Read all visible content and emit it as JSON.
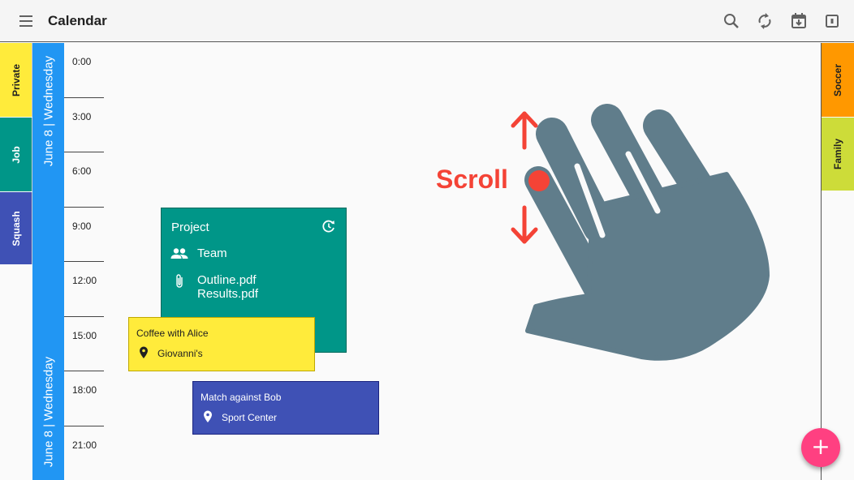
{
  "toolbar": {
    "title": "Calendar",
    "icons": [
      "menu-icon",
      "search-icon",
      "sync-icon",
      "calendar-download-icon",
      "view-day-icon"
    ]
  },
  "left_tabs": [
    {
      "label": "Private",
      "color": "#ffeb3b"
    },
    {
      "label": "Job",
      "color": "#009688"
    },
    {
      "label": "Squash",
      "color": "#3f51b5"
    }
  ],
  "right_tabs": [
    {
      "label": "Soccer",
      "color": "#ff9800"
    },
    {
      "label": "Family",
      "color": "#cddc39"
    }
  ],
  "date_strip": {
    "top_label": "June 8 | Wednesday",
    "bottom_label": "June 8 | Wednesday",
    "color": "#2196f3"
  },
  "times": [
    "0:00",
    "3:00",
    "6:00",
    "9:00",
    "12:00",
    "15:00",
    "18:00",
    "21:00"
  ],
  "events": {
    "project": {
      "title": "Project",
      "attendees": "Team",
      "attachment_1": "Outline.pdf",
      "attachment_2": "Results.pdf",
      "color": "#009688"
    },
    "coffee": {
      "title": "Coffee with Alice",
      "location": "Giovanni's",
      "color": "#ffeb3b"
    },
    "match": {
      "title": "Match against Bob",
      "location": "Sport Center",
      "color": "#3f51b5"
    }
  },
  "overlay": {
    "gesture_label": "Scroll",
    "gesture_icon": "hand-scroll-icon",
    "accent": "#f44336"
  },
  "fab": {
    "label": "+",
    "color": "#ff4081"
  }
}
